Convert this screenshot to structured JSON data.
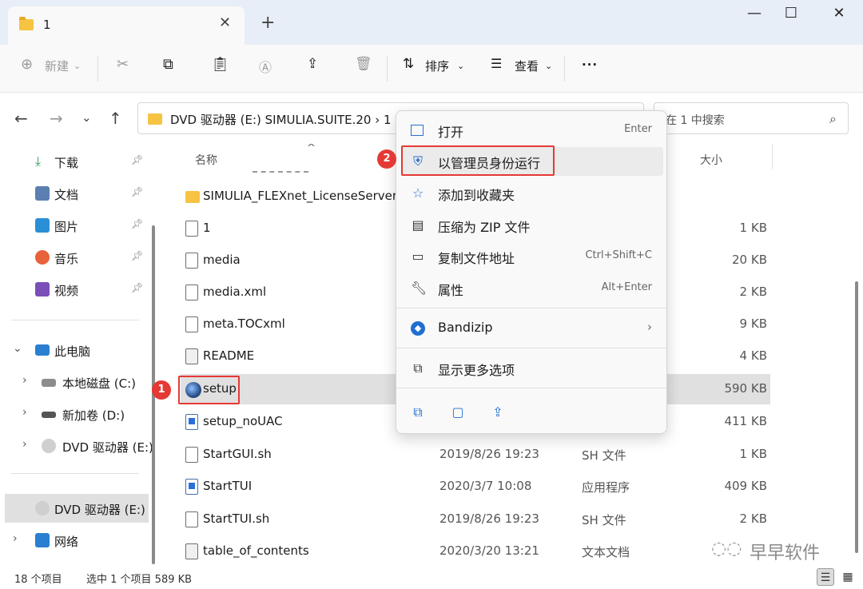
{
  "window": {
    "tab_title": "1",
    "tab_close": "✕",
    "new_tab": "+",
    "minimize": "—",
    "maximize": "☐",
    "close": "✕"
  },
  "toolbar": {
    "new_label": "新建",
    "sort_label": "排序",
    "view_label": "查看",
    "more_label": "···"
  },
  "address": {
    "path_text": "DVD 驱动器 (E:) SIMULIA.SUITE.20  ›  1",
    "search_placeholder": "在 1 中搜索"
  },
  "sidebar": {
    "quick": [
      {
        "label": "下载",
        "icon": "download-icon",
        "color": "#2e9a55"
      },
      {
        "label": "文档",
        "icon": "document-icon",
        "color": "#5b7fb2"
      },
      {
        "label": "图片",
        "icon": "pictures-icon",
        "color": "#2a8fd6"
      },
      {
        "label": "音乐",
        "icon": "music-icon",
        "color": "#e8623a"
      },
      {
        "label": "视频",
        "icon": "video-icon",
        "color": "#7b4fb8"
      }
    ],
    "this_pc": "此电脑",
    "drives": [
      {
        "label": "本地磁盘 (C:)",
        "icon": "drive-c-icon"
      },
      {
        "label": "新加卷 (D:)",
        "icon": "drive-d-icon"
      },
      {
        "label": "DVD 驱动器 (E:)",
        "icon": "dvd-icon"
      }
    ],
    "selected": "DVD 驱动器 (E:) S",
    "network": "网络"
  },
  "filelist": {
    "col_name": "名称",
    "col_size": "大小",
    "rows": [
      {
        "name": "SIMULIA_FLEXnet_LicenseServer",
        "date": "",
        "type": "",
        "size": "",
        "icon": "folder-icon"
      },
      {
        "name": "1",
        "date": "",
        "type": "",
        "size": "1 KB",
        "icon": "file-icon"
      },
      {
        "name": "media",
        "date": "",
        "type": "",
        "size": "20 KB",
        "icon": "file-gear-icon"
      },
      {
        "name": "media.xml",
        "date": "",
        "type": "",
        "size": "2 KB",
        "icon": "file-icon"
      },
      {
        "name": "meta.TOCxml",
        "date": "",
        "type": "",
        "size": "9 KB",
        "icon": "file-icon"
      },
      {
        "name": "README",
        "date": "",
        "type": "",
        "size": "4 KB",
        "icon": "text-file-icon"
      },
      {
        "name": "setup",
        "date": "",
        "type": "",
        "size": "590 KB",
        "icon": "setup-globe-icon"
      },
      {
        "name": "setup_noUAC",
        "date": "",
        "type": "",
        "size": "411 KB",
        "icon": "exe-icon"
      },
      {
        "name": "StartGUI.sh",
        "date": "2019/8/26 19:23",
        "type": "SH 文件",
        "size": "1 KB",
        "icon": "file-icon"
      },
      {
        "name": "StartTUI",
        "date": "2020/3/7 10:08",
        "type": "应用程序",
        "size": "409 KB",
        "icon": "exe-icon"
      },
      {
        "name": "StartTUI.sh",
        "date": "2019/8/26 19:23",
        "type": "SH 文件",
        "size": "2 KB",
        "icon": "file-icon"
      },
      {
        "name": "table_of_contents",
        "date": "2020/3/20 13:21",
        "type": "文本文档",
        "size": "",
        "icon": "text-file-icon"
      }
    ]
  },
  "context_menu": {
    "open": "打开",
    "open_short": "Enter",
    "run_admin": "以管理员身份运行",
    "add_fav": "添加到收藏夹",
    "zip": "压缩为 ZIP 文件",
    "copy_path": "复制文件地址",
    "copy_path_short": "Ctrl+Shift+C",
    "properties": "属性",
    "properties_short": "Alt+Enter",
    "bandizip": "Bandizip",
    "more_options": "显示更多选项"
  },
  "annotations": {
    "badge1": "1",
    "badge2": "2"
  },
  "status": {
    "count": "18 个项目",
    "selected": "选中 1 个项目  589 KB"
  },
  "watermark": "早早软件"
}
